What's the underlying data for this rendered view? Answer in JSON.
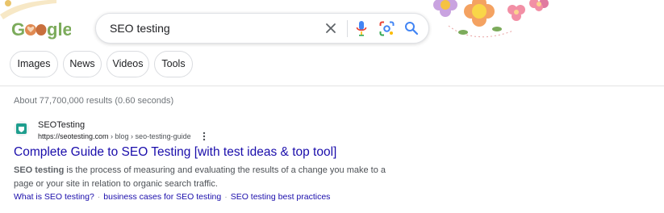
{
  "header": {
    "logo_text": "Google",
    "search": {
      "value": "SEO testing"
    },
    "icons": [
      "clear-icon",
      "mic-icon",
      "lens-icon",
      "search-icon"
    ]
  },
  "filters": [
    "Images",
    "News",
    "Videos",
    "Tools"
  ],
  "results_stats": "About 77,700,000 results (0.60 seconds)",
  "result": {
    "site_name": "SEOTesting",
    "url_host": "https://seotesting.com",
    "url_path": " › blog › seo-testing-guide",
    "title": "Complete Guide to SEO Testing [with test ideas & top tool]",
    "snippet_bold": "SEO testing",
    "snippet_rest": " is the process of measuring and evaluating the results of a change you make to a page or your site in relation to organic search traffic.",
    "sitelinks": [
      "What is SEO testing?",
      "business cases for SEO testing",
      "SEO testing best practices"
    ]
  },
  "colors": {
    "link": "#1a0dab",
    "google_blue": "#4285f4",
    "google_red": "#ea4335",
    "google_yellow": "#fbbc05",
    "google_green": "#34a853"
  }
}
